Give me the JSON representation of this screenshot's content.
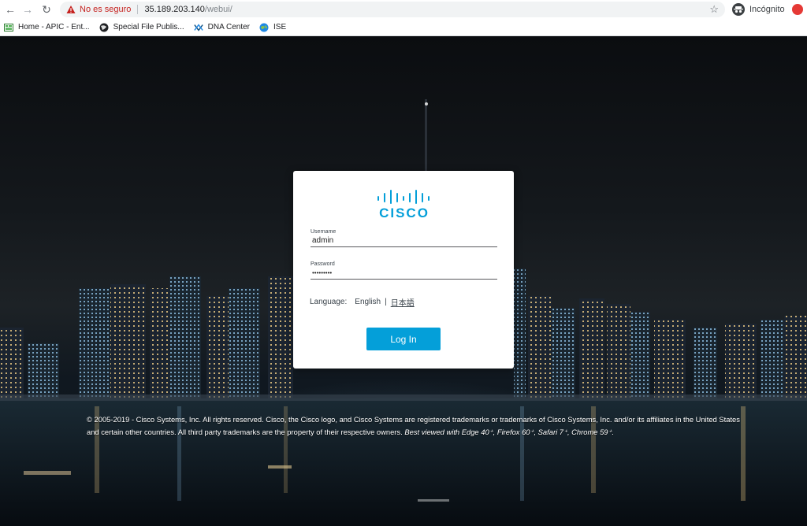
{
  "browser": {
    "security_label": "No es seguro",
    "url_host": "35.189.203.140",
    "url_path": "/webui/",
    "incognito_label": "Incógnito",
    "bookmarks": [
      {
        "label": "Home - APIC - Ent...",
        "icon": "apic-icon"
      },
      {
        "label": "Special File Publis...",
        "icon": "globe-icon"
      },
      {
        "label": "DNA Center",
        "icon": "dna-center-icon"
      },
      {
        "label": "ISE",
        "icon": "ise-globe-icon"
      }
    ]
  },
  "login": {
    "logo_text": "CISCO",
    "username_label": "Username",
    "username_value": "admin",
    "password_label": "Password",
    "password_value": "•••••••••",
    "language_label": "Language:",
    "language_english": "English",
    "language_separator": "|",
    "language_japanese": "日本語",
    "login_button": "Log In"
  },
  "footer": {
    "copyright": "© 2005-2019 - Cisco Systems, Inc. All rights reserved. Cisco, the Cisco logo, and Cisco Systems are registered trademarks or trademarks of Cisco Systems, Inc. and/or its affiliates in the United States and certain other countries. All third party trademarks are the property of their respective owners.",
    "best_viewed": "Best viewed with Edge 40⁺,  Firefox 60⁺,  Safari 7⁺,  Chrome 59⁺."
  },
  "colors": {
    "cisco_blue": "#049fd9",
    "security_warning": "#c5221f"
  }
}
